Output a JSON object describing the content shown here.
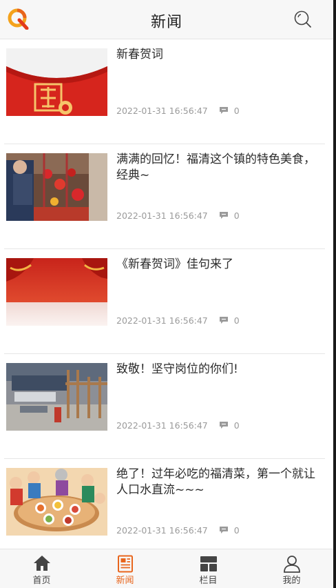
{
  "header": {
    "title": "新闻",
    "logo_icon": "q-logo-icon",
    "search_icon": "search-icon"
  },
  "articles": [
    {
      "title": "新春贺词",
      "date": "2022-01-31 16:56:47",
      "comments": "0",
      "thumb": "red-envelope"
    },
    {
      "title": "满满的回忆！福清这个镇的特色美食，经典~",
      "date": "2022-01-31 16:56:47",
      "comments": "0",
      "thumb": "market-stall"
    },
    {
      "title": "《新春贺词》佳句来了",
      "date": "2022-01-31 16:56:47",
      "comments": "0",
      "thumb": "red-curtain"
    },
    {
      "title": "致敬！坚守岗位的你们!",
      "date": "2022-01-31 16:56:47",
      "comments": "0",
      "thumb": "factory"
    },
    {
      "title": "绝了！过年必吃的福清菜，第一个就让人口水直流~~~",
      "date": "2022-01-31 16:56:47",
      "comments": "0",
      "thumb": "family-dinner"
    }
  ],
  "tabbar": {
    "tabs": [
      {
        "label": "首页",
        "icon": "home-icon",
        "active": false
      },
      {
        "label": "新闻",
        "icon": "news-icon",
        "active": true
      },
      {
        "label": "栏目",
        "icon": "columns-icon",
        "active": false
      },
      {
        "label": "我的",
        "icon": "profile-icon",
        "active": false
      }
    ]
  },
  "colors": {
    "accent": "#e8651c",
    "text": "#2b2b2b",
    "meta": "#9a9a9a"
  }
}
